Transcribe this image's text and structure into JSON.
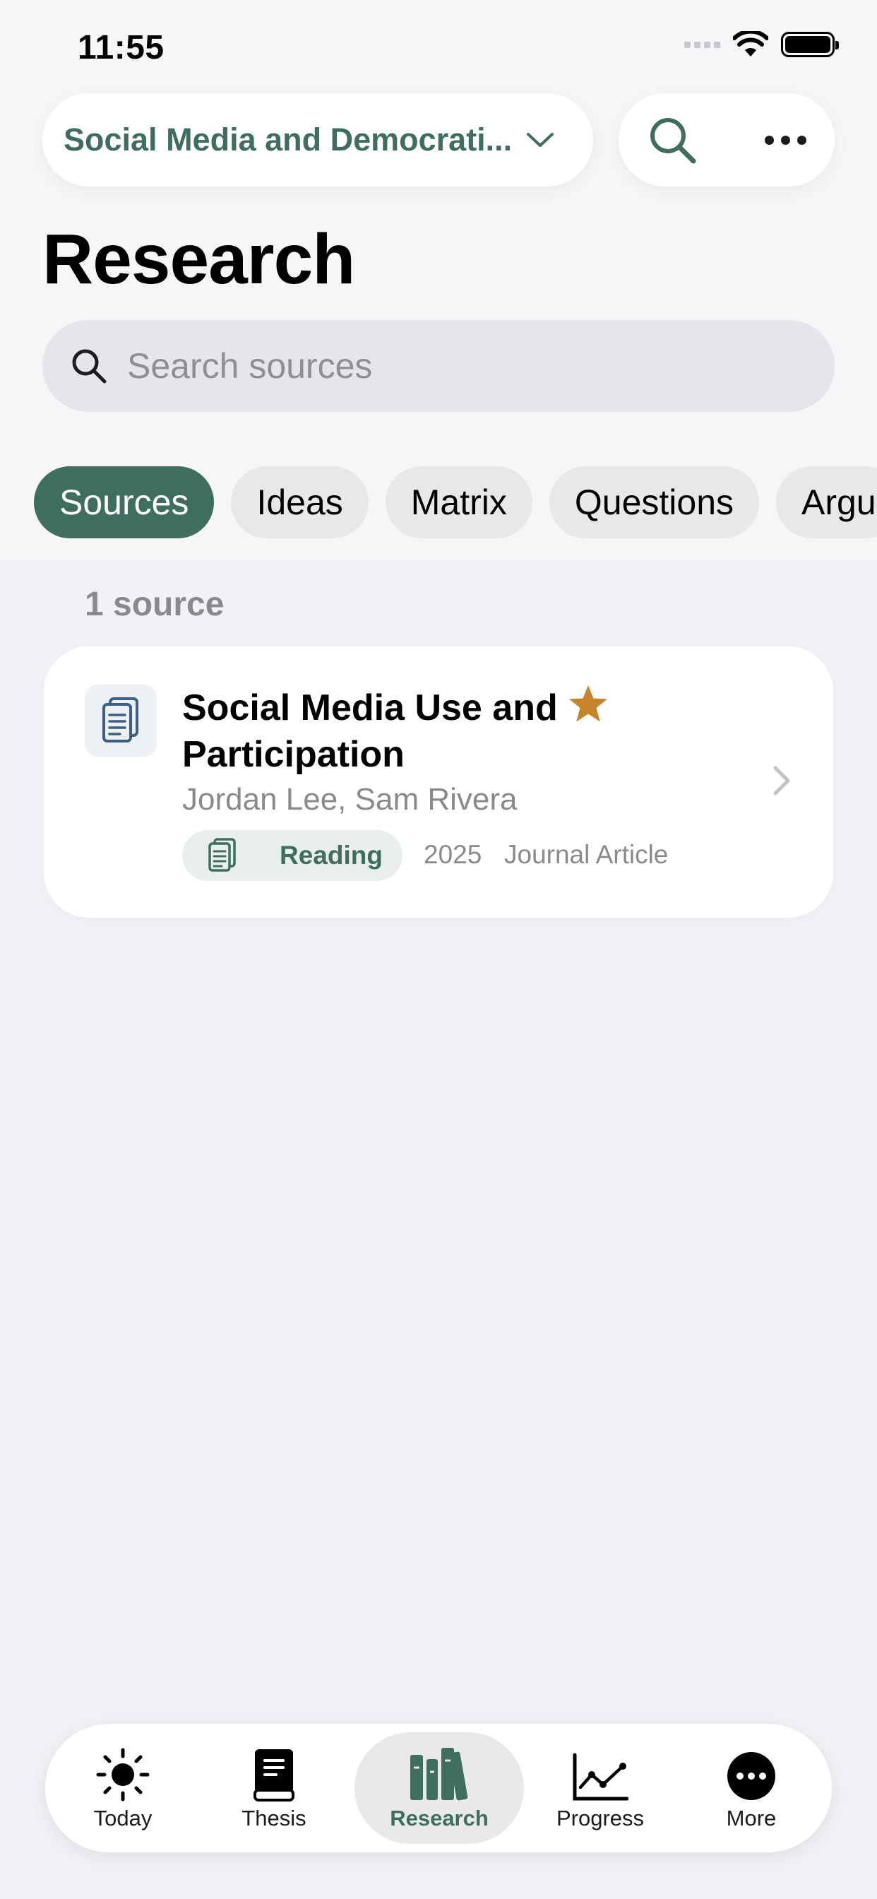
{
  "status_bar": {
    "time": "11:55"
  },
  "header": {
    "project_title": "Social Media and Democrati...",
    "chevron_icon": "chevron-down-icon",
    "search_icon": "search-icon",
    "more_icon": "ellipsis-icon"
  },
  "page": {
    "title": "Research"
  },
  "search": {
    "placeholder": "Search sources",
    "value": ""
  },
  "tabs": [
    {
      "label": "Sources",
      "active": true
    },
    {
      "label": "Ideas",
      "active": false
    },
    {
      "label": "Matrix",
      "active": false
    },
    {
      "label": "Questions",
      "active": false
    },
    {
      "label": "Argu",
      "active": false
    }
  ],
  "sources": {
    "count_label": "1 source",
    "items": [
      {
        "title": "Social Media Use and Participation",
        "authors": "Jordan Lee, Sam Rivera",
        "status": "Reading",
        "year": "2025",
        "type": "Journal Article",
        "starred": true
      }
    ]
  },
  "tabbar": {
    "items": [
      {
        "label": "Today",
        "icon": "sun-icon"
      },
      {
        "label": "Thesis",
        "icon": "book-icon"
      },
      {
        "label": "Research",
        "icon": "books-icon",
        "active": true
      },
      {
        "label": "Progress",
        "icon": "chart-line-icon"
      },
      {
        "label": "More",
        "icon": "more-circle-icon"
      }
    ]
  },
  "colors": {
    "accent": "#3f6e5f",
    "star": "#c8842b",
    "doc_icon": "#3d5f86",
    "background": "#f2f2f6"
  }
}
